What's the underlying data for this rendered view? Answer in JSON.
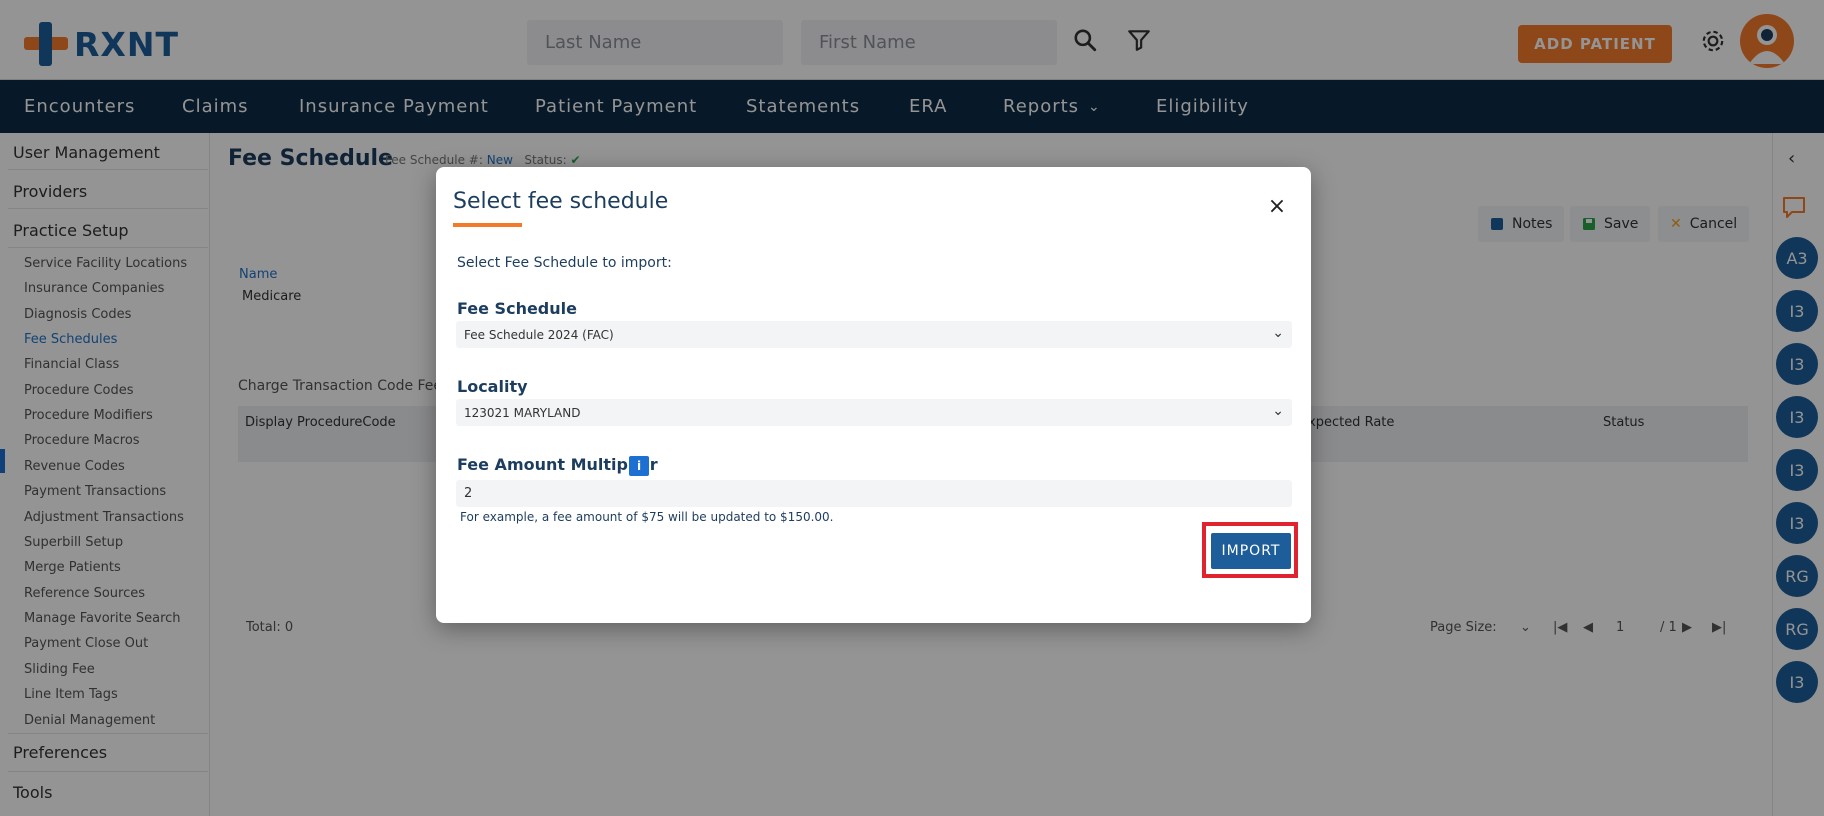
{
  "header": {
    "logo_text": "RXNT",
    "last_name_placeholder": "Last Name",
    "first_name_placeholder": "First Name",
    "add_patient_label": "ADD PATIENT"
  },
  "nav": {
    "items": [
      "Encounters",
      "Claims",
      "Insurance Payment",
      "Patient Payment",
      "Statements",
      "ERA",
      "Reports",
      "Eligibility"
    ]
  },
  "sidebar": {
    "sections": [
      "User Management",
      "Providers",
      "Practice Setup",
      "Preferences",
      "Tools"
    ],
    "practice_setup_items": [
      "Service Facility Locations",
      "Insurance Companies",
      "Diagnosis Codes",
      "Fee Schedules",
      "Financial Class",
      "Procedure Codes",
      "Procedure Modifiers",
      "Procedure Macros",
      "Revenue Codes",
      "Payment Transactions",
      "Adjustment Transactions",
      "Superbill Setup",
      "Merge Patients",
      "Reference Sources",
      "Manage Favorite Search",
      "Payment Close Out",
      "Sliding Fee",
      "Line Item Tags",
      "Denial Management"
    ],
    "active_item": "Fee Schedules"
  },
  "page": {
    "title": "Fee Schedule",
    "meta_label": "Fee Schedule #:",
    "meta_value": "New",
    "status_label": "Status:",
    "toolbar": {
      "notes": "Notes",
      "save": "Save",
      "cancel": "Cancel"
    },
    "name_label": "Name",
    "name_value": "Medicare",
    "section_label": "Charge Transaction Code FeeS",
    "grid_columns": [
      "Display ProcedureCode",
      "xpected Rate",
      "Status"
    ],
    "total": "Total: 0",
    "page_size_label": "Page Size:",
    "page_number": "1",
    "page_total": "/ 1"
  },
  "right_rail": {
    "badges": [
      "A3",
      "I3",
      "I3",
      "I3",
      "I3",
      "I3",
      "RG",
      "RG",
      "I3"
    ]
  },
  "modal": {
    "title": "Select fee schedule",
    "close_label": "×",
    "subtitle": "Select Fee Schedule to import:",
    "fee_schedule_label": "Fee Schedule",
    "fee_schedule_value": "Fee Schedule 2024 (FAC)",
    "locality_label": "Locality",
    "locality_value": "123021 MARYLAND",
    "multiplier_label": "Fee Amount Multiplier",
    "multiplier_value": "2",
    "hint": "For example, a fee amount of $75 will be updated to $150.00.",
    "import_label": "IMPORT"
  },
  "colors": {
    "brand_blue": "#1c5d9a",
    "brand_orange": "#f47a2b",
    "nav_bg": "#0d2a45",
    "highlight_red": "#e0242f"
  }
}
